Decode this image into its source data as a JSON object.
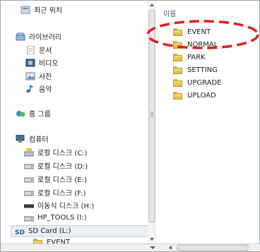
{
  "nav": {
    "items": [
      {
        "label": "최근 위치",
        "icon": "recent-places-icon"
      },
      {
        "label": "라이브러리",
        "icon": "library-icon"
      },
      {
        "label": "문서",
        "icon": "documents-icon"
      },
      {
        "label": "비디오",
        "icon": "video-icon"
      },
      {
        "label": "사진",
        "icon": "pictures-icon"
      },
      {
        "label": "음악",
        "icon": "music-icon"
      },
      {
        "label": "홈 그룹",
        "icon": "homegroup-icon"
      },
      {
        "label": "컴퓨터",
        "icon": "computer-icon"
      },
      {
        "label": "로컬 디스크 (C:)",
        "icon": "system-drive-icon"
      },
      {
        "label": "로컬 디스크 (D:)",
        "icon": "drive-icon"
      },
      {
        "label": "로컬 디스크 (E:)",
        "icon": "drive-icon"
      },
      {
        "label": "로컬 디스크 (F:)",
        "icon": "drive-icon"
      },
      {
        "label": "이동식 디스크 (H:)",
        "icon": "removable-drive-icon"
      },
      {
        "label": "HP_TOOLS (I:)",
        "icon": "drive-icon"
      },
      {
        "label": "SD Card (L:)",
        "icon": "sd-card-icon"
      },
      {
        "label": "EVENT",
        "icon": "folder-icon"
      }
    ],
    "selected": "SD Card (L:)"
  },
  "files": {
    "column_header": "이름",
    "items": [
      "EVENT",
      "NORMAL",
      "PARK",
      "SETTING",
      "UPGRADE",
      "UPLOAD"
    ]
  },
  "colors": {
    "annotation": "#e0201c",
    "folder": "#f0cc5a",
    "header_text": "#4c607a"
  }
}
